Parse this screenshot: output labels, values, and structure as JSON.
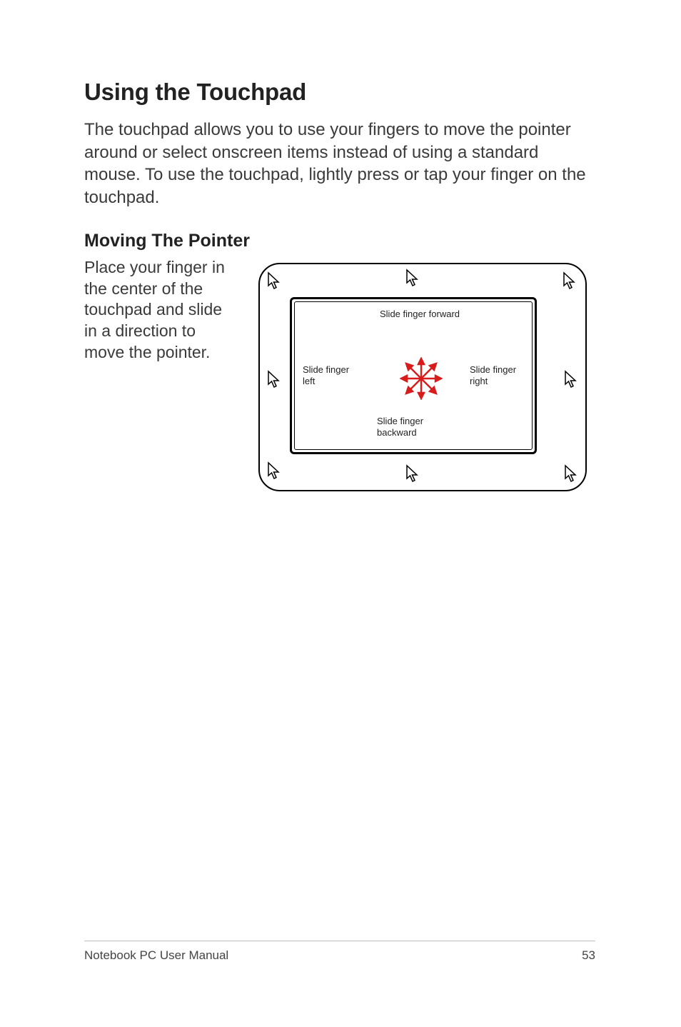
{
  "section_title": "Using the Touchpad",
  "intro_paragraph": "The touchpad allows you to use your fingers to move the pointer around or select onscreen items instead of using a standard mouse. To use the touchpad, lightly press or tap your finger on the touchpad.",
  "subsection_title": "Moving The Pointer",
  "instruction_paragraph": "Place your finger in the center of the touchpad and slide in a direction to move the pointer.",
  "diagram": {
    "label_forward": "Slide finger forward",
    "label_left": "Slide finger left",
    "label_right": "Slide finger right",
    "label_backward": "Slide finger backward"
  },
  "footer": {
    "manual_title": "Notebook PC User Manual",
    "page_number": "53"
  }
}
